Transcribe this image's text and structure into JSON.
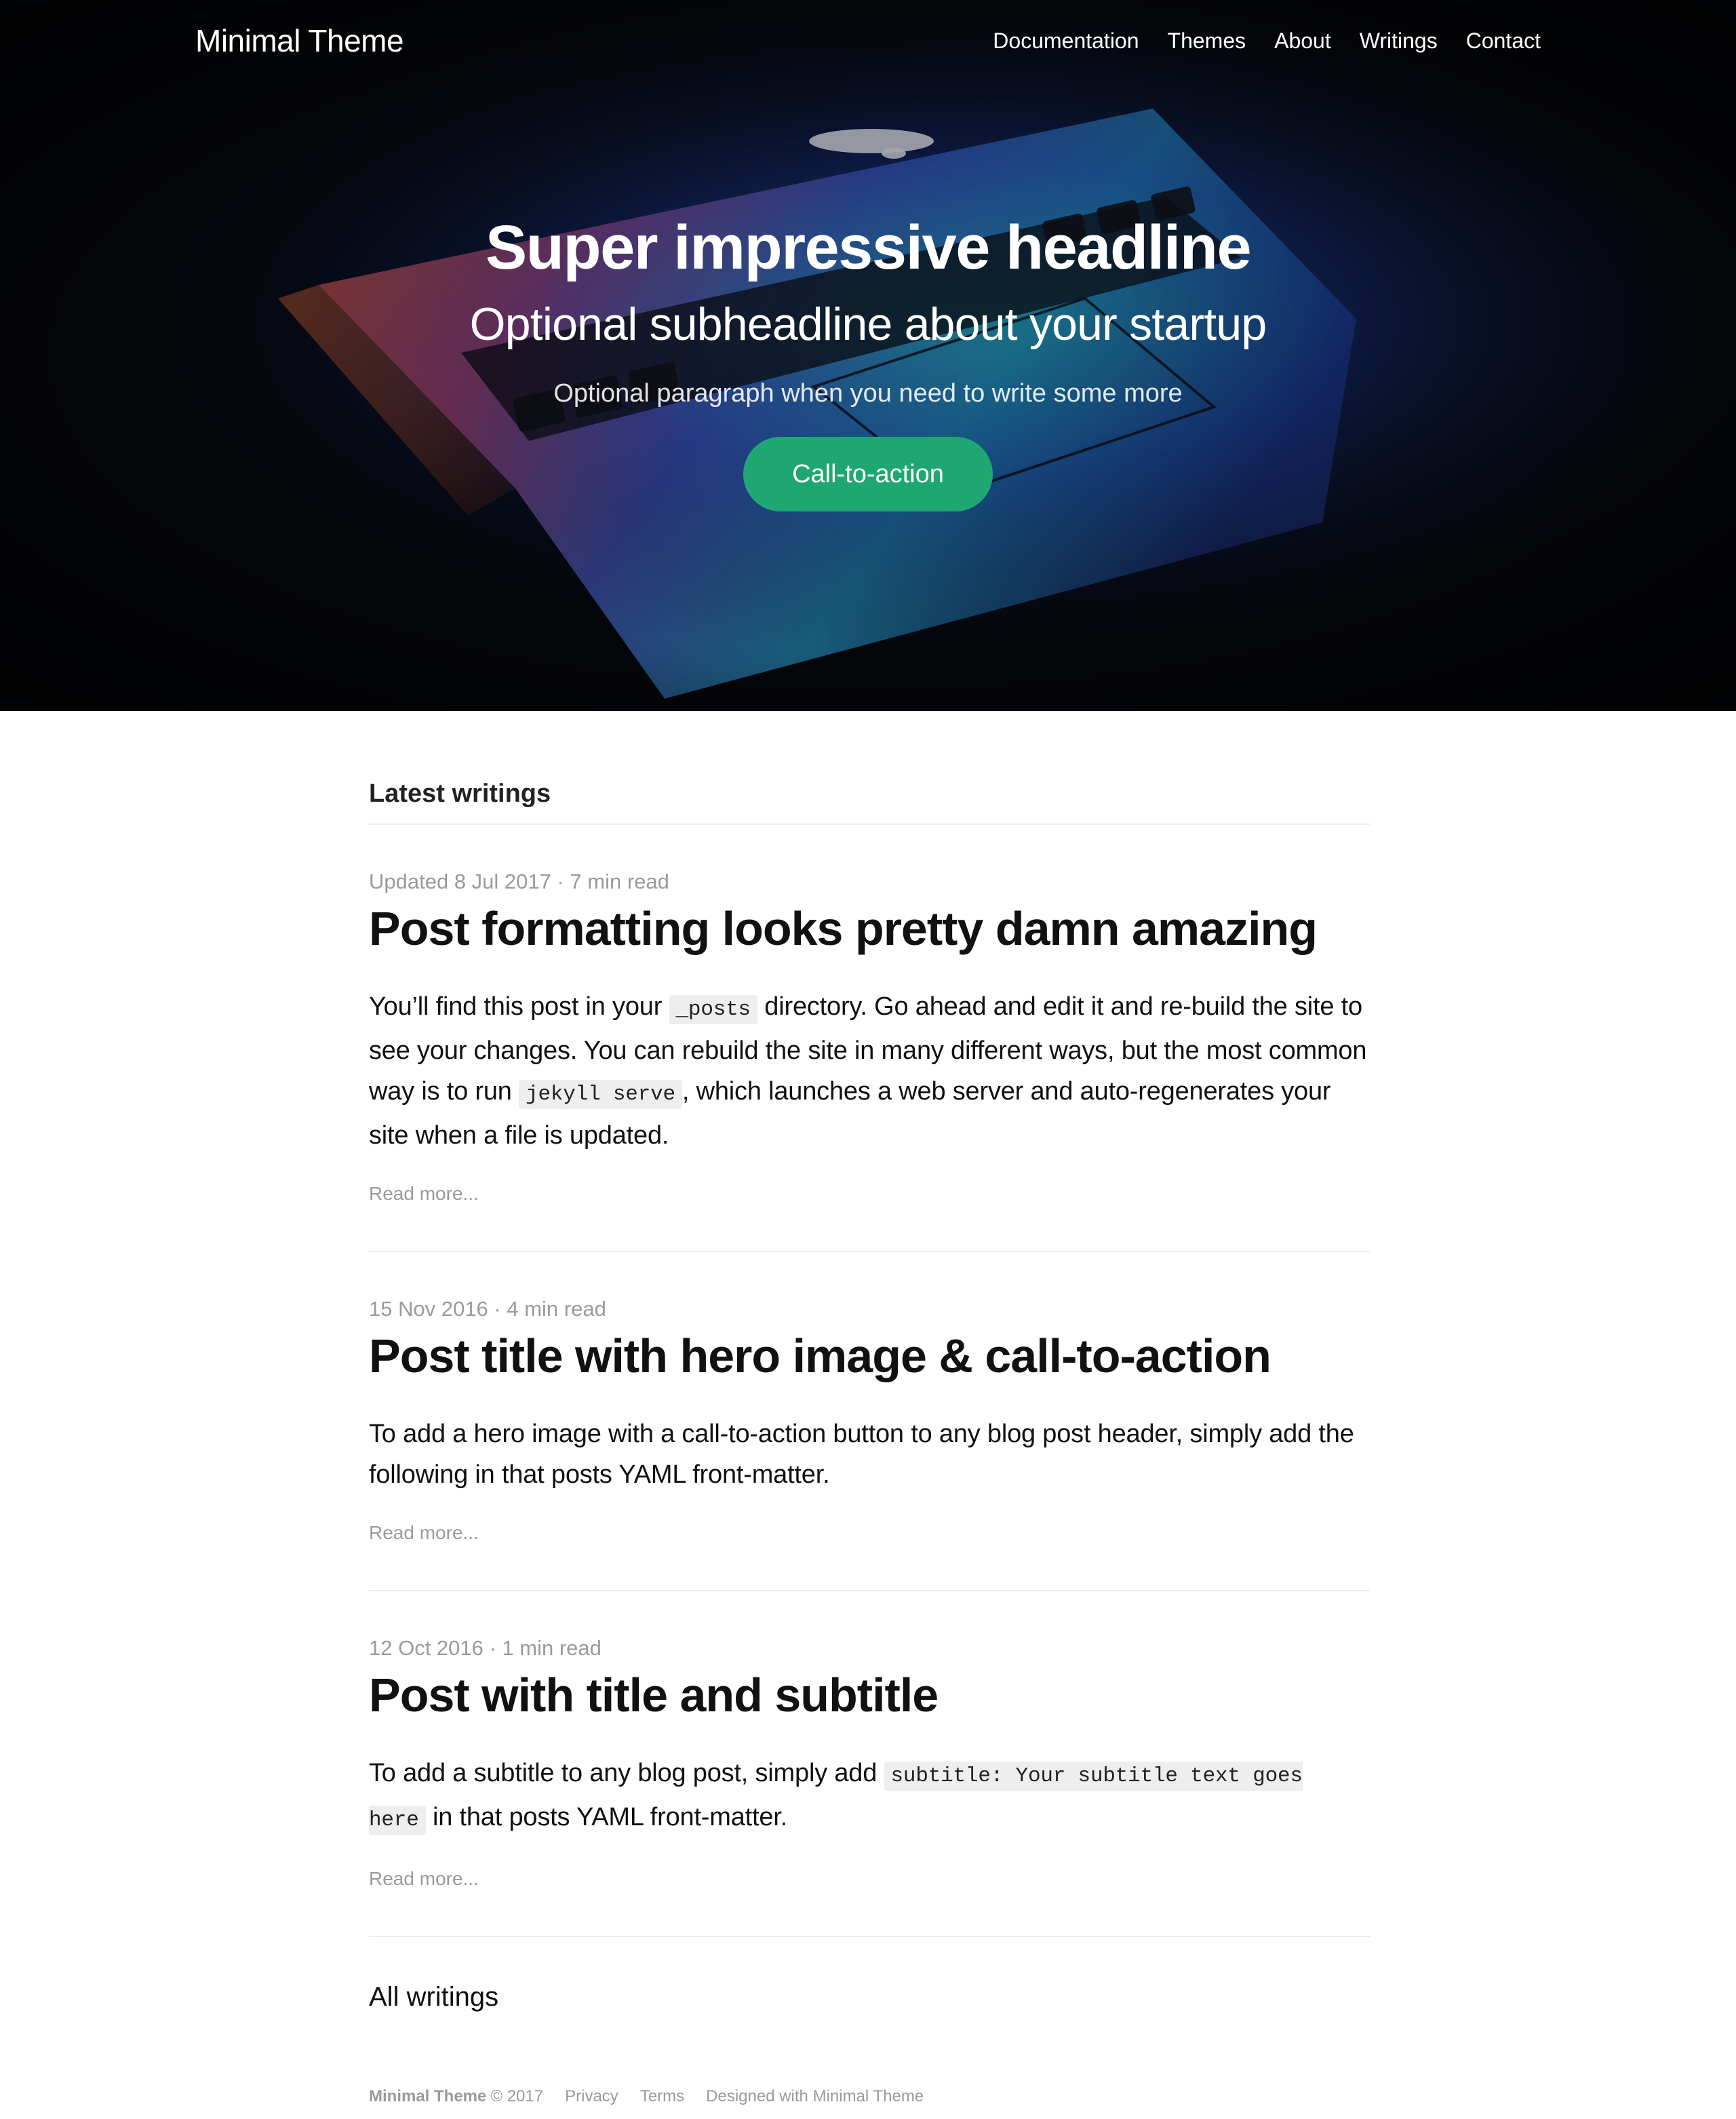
{
  "nav": {
    "brand": "Minimal Theme",
    "links": [
      "Documentation",
      "Themes",
      "About",
      "Writings",
      "Contact"
    ]
  },
  "hero": {
    "title": "Super impressive headline",
    "subtitle": "Optional subheadline about your startup",
    "paragraph": "Optional paragraph when you need to write some more",
    "cta": "Call-to-action",
    "image_icon": "laptop-photo"
  },
  "writings": {
    "heading": "Latest writings",
    "posts": [
      {
        "meta": "Updated 8 Jul 2017 · 7 min read",
        "title": "Post formatting looks pretty damn amazing",
        "excerpt": [
          "You’ll find this post in your ",
          "_posts",
          " directory. Go ahead and edit it and re-build the site to see your changes. You can rebuild the site in many different ways, but the most common way is to run ",
          "jekyll serve",
          ", which launches a web server and auto-regenerates your site when a file is updated."
        ],
        "read_more": "Read more..."
      },
      {
        "meta": "15 Nov 2016 · 4 min read",
        "title": "Post title with hero image & call-to-action",
        "excerpt": [
          "To add a hero image with a call-to-action button to any blog post header, simply add the following in that posts YAML front-matter."
        ],
        "read_more": "Read more..."
      },
      {
        "meta": "12 Oct 2016 · 1 min read",
        "title": "Post with title and subtitle",
        "excerpt": [
          "To add a subtitle to any blog post, simply add ",
          "subtitle: Your subtitle text goes here",
          " in that posts YAML front-matter."
        ],
        "read_more": "Read more..."
      }
    ],
    "all_link": "All writings"
  },
  "footer": {
    "brand": "Minimal Theme",
    "copyright": "© 2017",
    "links": [
      "Privacy",
      "Terms",
      "Designed with Minimal Theme"
    ]
  },
  "colors": {
    "accent": "#1ea772",
    "hero_bg": "#07080c",
    "muted_text": "#9a9a9a",
    "code_bg": "#eeeeee"
  }
}
